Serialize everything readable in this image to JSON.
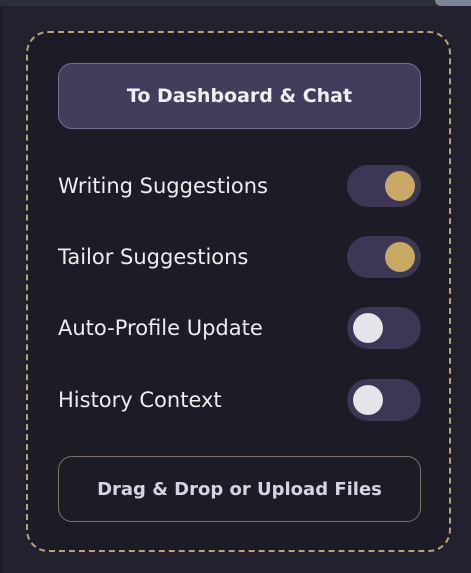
{
  "panel": {
    "dashboard_button": "To Dashboard & Chat",
    "toggles": [
      {
        "label": "Writing Suggestions",
        "on": true
      },
      {
        "label": "Tailor Suggestions",
        "on": true
      },
      {
        "label": "Auto-Profile Update",
        "on": false
      },
      {
        "label": "History Context",
        "on": false
      }
    ],
    "upload_button": "Drag & Drop or Upload Files"
  },
  "colors": {
    "accent_gold": "#c8a964",
    "toggle_track": "#3b3755",
    "dashed_border": "#b9a27a",
    "button_fill": "#433d5d"
  }
}
